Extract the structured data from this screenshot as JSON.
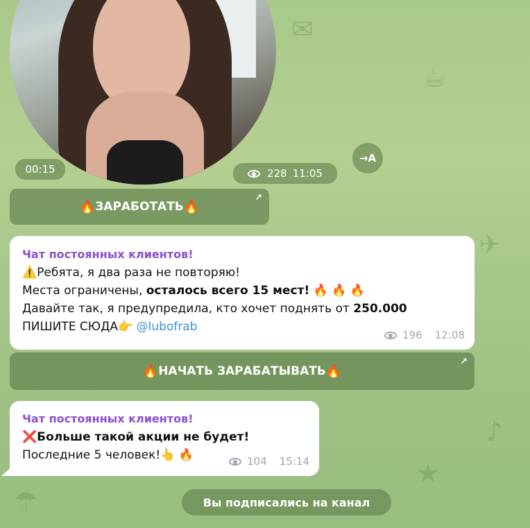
{
  "video": {
    "duration": "00:15",
    "views": "228",
    "time": "11:05",
    "forward_label": "→A"
  },
  "button1": {
    "label": "ЗАРАБОТАТЬ",
    "prefix_emoji": "🔥",
    "suffix_emoji": "🔥"
  },
  "message1": {
    "sender": "Чат постоянных клиентов!",
    "line1_emoji": "⚠️",
    "line1": "Ребята, я два раза не повторяю!",
    "line2_plain": "Места ограничены, ",
    "line2_bold": "осталось всего 15 мест!",
    "line2_emoji": "🔥 🔥 🔥",
    "line3_plain": "Давайте так, я предупредила, кто хочет поднять от ",
    "line3_bold": "250.000",
    "line4_plain": "ПИШИТЕ СЮДА",
    "line4_emoji": "👉",
    "line4_link": "@lubofrab",
    "views": "196",
    "time": "12:08"
  },
  "button2": {
    "label": "НАЧАТЬ ЗАРАБАТЫВАТЬ",
    "prefix_emoji": "🔥",
    "suffix_emoji": "🔥"
  },
  "message2": {
    "sender": "Чат постоянных клиентов!",
    "line1_emoji": "❌",
    "line1_bold": "Больше такой акции не будет!",
    "line2": "Последние 5 человек!",
    "line2_emoji": "👆 🔥",
    "views": "104",
    "time": "15:14"
  },
  "service": {
    "label": "Вы подписались на канал"
  }
}
